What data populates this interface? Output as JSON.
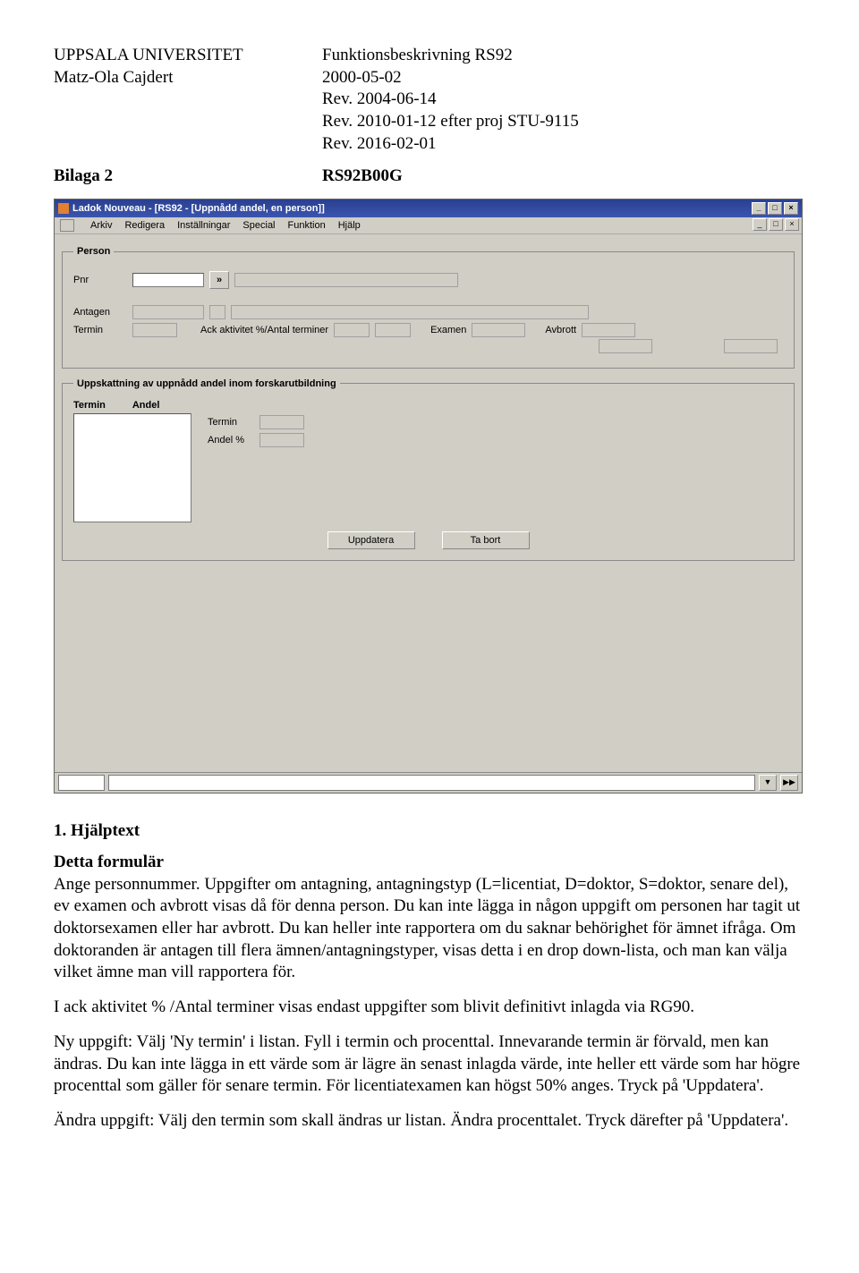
{
  "header": {
    "left_line1": "UPPSALA UNIVERSITET",
    "left_line2": "Matz-Ola Cajdert",
    "right_line1": "Funktionsbeskrivning RS92",
    "right_line2": "2000-05-02",
    "right_line3": "Rev. 2004-06-14",
    "right_line4": "Rev. 2010-01-12 efter proj STU-9115",
    "right_line5": "Rev. 2016-02-01",
    "bilaga_label": "Bilaga 2",
    "bilaga_code": "RS92B00G"
  },
  "app": {
    "title": "Ladok Nouveau - [RS92 - [Uppnådd andel, en person]]",
    "menu": [
      "Arkiv",
      "Redigera",
      "Inställningar",
      "Special",
      "Funktion",
      "Hjälp"
    ],
    "legend_person": "Person",
    "lbl_pnr": "Pnr",
    "lbl_antagen": "Antagen",
    "lbl_termin": "Termin",
    "lbl_ack": "Ack aktivitet %/Antal terminer",
    "lbl_examen": "Examen",
    "lbl_avbrott": "Avbrott",
    "legend_upp": "Uppskattning av uppnådd andel inom forskarutbildning",
    "col_termin": "Termin",
    "col_andel": "Andel",
    "lbl_termin2": "Termin",
    "lbl_andelpct": "Andel %",
    "btn_uppdatera": "Uppdatera",
    "btn_tabort": "Ta bort",
    "win_min": "_",
    "win_max": "□",
    "win_close": "×",
    "dd": "▼",
    "nav": "▶▶",
    "expand": "»"
  },
  "help": {
    "h1": "1.  Hjälptext",
    "h2": "Detta formulär",
    "p1": "Ange personnummer. Uppgifter om antagning, antagningstyp (L=licentiat, D=doktor, S=doktor, senare del), ev examen och avbrott visas då för denna person. Du kan inte lägga in någon uppgift om personen har tagit ut doktorsexamen eller har avbrott. Du kan heller inte rapportera om du saknar behörighet för ämnet ifråga. Om doktoranden är antagen till flera ämnen/antagningstyper, visas detta i en drop down-lista, och man kan välja vilket ämne man vill rapportera för.",
    "p2": "I ack aktivitet % /Antal terminer visas endast uppgifter som blivit definitivt inlagda via RG90.",
    "p3": "Ny uppgift: Välj 'Ny termin' i listan. Fyll i termin och procenttal. Innevarande termin är förvald, men kan ändras. Du kan inte lägga in ett värde som är lägre än senast inlagda värde, inte heller ett värde som har högre procenttal som gäller för senare termin. För licentiatexamen kan högst 50% anges. Tryck på 'Uppdatera'.",
    "p4": "Ändra uppgift: Välj den termin som skall ändras ur listan. Ändra procenttalet. Tryck därefter på 'Uppdatera'."
  }
}
